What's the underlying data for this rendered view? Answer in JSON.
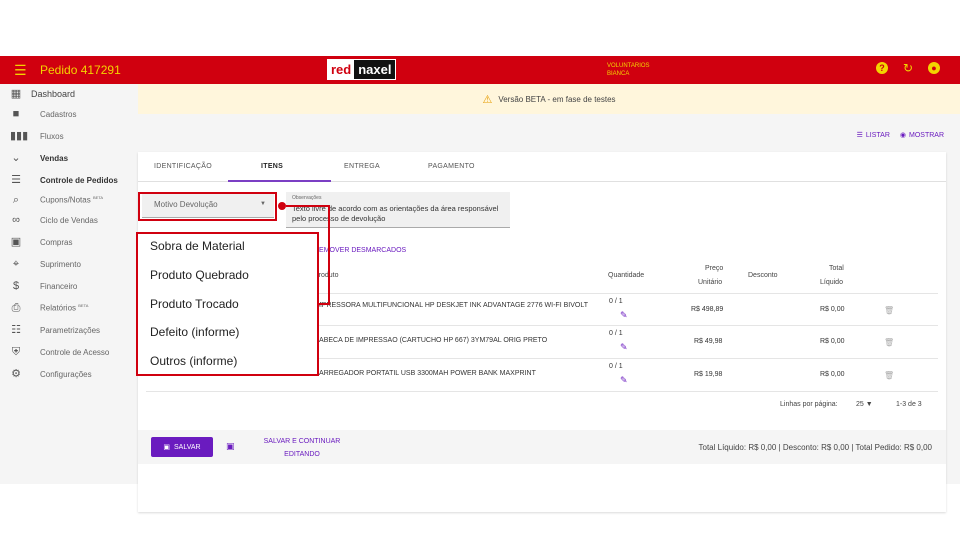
{
  "topbar": {
    "menu_icon": "hamburger-icon",
    "order_title": "Pedido 417291",
    "logo_red": "red",
    "logo_naxel": "naxel",
    "user_line1": "VOLUNTARIOS",
    "user_line2": "BIANCA",
    "help_icon": "help-icon",
    "refresh_icon": "refresh-icon",
    "account_icon": "account-icon"
  },
  "sidebar": {
    "items": [
      {
        "label": "Dashboard",
        "icon": "dashboard-icon"
      },
      {
        "label": "Cadastros",
        "icon": "folder-icon"
      },
      {
        "label": "Fluxos",
        "icon": "columns-icon"
      },
      {
        "label": "Vendas",
        "icon": "chevron-down-icon"
      },
      {
        "label": "Controle de Pedidos",
        "icon": "list-icon"
      },
      {
        "label": "Cupons/Notas",
        "badge": "BETA",
        "icon": "magnify-doc-icon"
      },
      {
        "label": "Ciclo de Vendas",
        "icon": "infinity-icon"
      },
      {
        "label": "Compras",
        "icon": "building-icon"
      },
      {
        "label": "Suprimento",
        "icon": "box-icon"
      },
      {
        "label": "Financeiro",
        "icon": "dollar-icon"
      },
      {
        "label": "Relatórios",
        "badge": "BETA",
        "icon": "printer-icon"
      },
      {
        "label": "Parametrizações",
        "icon": "tune-icon"
      },
      {
        "label": "Controle de Acesso",
        "icon": "shield-icon"
      },
      {
        "label": "Configurações",
        "icon": "gear-icon"
      }
    ]
  },
  "banner": {
    "text": "Versão BETA - em fase de testes",
    "icon": "warning-icon"
  },
  "view": {
    "list_label": "LISTAR",
    "show_label": "MOSTRAR"
  },
  "tabs": [
    {
      "label": "IDENTIFICAÇÃO"
    },
    {
      "label": "ITENS"
    },
    {
      "label": "ENTREGA"
    },
    {
      "label": "PAGAMENTO"
    }
  ],
  "form": {
    "motivo_value": "Motivo Devolução",
    "obs_label": "Observações",
    "obs_text": "Texto livre de acordo com as orientações da área responsável pelo processo de devolução"
  },
  "items": {
    "remove_label": "REMOVER DESMARCADOS",
    "headers": {
      "produto": "Produto",
      "quantidade": "Quantidade",
      "preco1": "Preço",
      "preco2": "Unitário",
      "desconto": "Desconto",
      "total1": "Total",
      "total2": "Líquido"
    },
    "rows": [
      {
        "produto": "IMPRESSORA MULTIFUNCIONAL HP DESKJET INK ADVANTAGE 2776 WI-FI BIVOLT",
        "qtd": "0 / 1",
        "preco": "R$ 498,89",
        "total": "R$ 0,00"
      },
      {
        "produto": "CABECA DE IMPRESSAO (CARTUCHO HP 667) 3YM79AL ORIG PRETO",
        "qtd": "0 / 1",
        "preco": "R$ 49,98",
        "total": "R$ 0,00"
      },
      {
        "produto": "CARREGADOR PORTATIL USB 3300MAH POWER BANK MAXPRINT",
        "qtd": "0 / 1",
        "preco": "R$ 19,98",
        "total": "R$ 0,00"
      }
    ],
    "rows_per_page_label": "Linhas por página:",
    "rows_per_page": "25",
    "range": "1-3 de 3"
  },
  "footer": {
    "save_label": "SALVAR",
    "save_continue_1": "SALVAR E CONTINUAR",
    "save_continue_2": "EDITANDO",
    "totals": "Total Líquido: R$ 0,00 | Desconto: R$ 0,00 | Total Pedido: R$ 0,00"
  },
  "dropdown": {
    "options": [
      "Sobra de Material",
      "Produto Quebrado",
      "Produto Trocado",
      "Defeito (informe)",
      "Outros (informe)"
    ]
  },
  "colors": {
    "brand_red": "#d0000f",
    "brand_yellow": "#f3d400",
    "accent_purple": "#6a1bbf"
  }
}
